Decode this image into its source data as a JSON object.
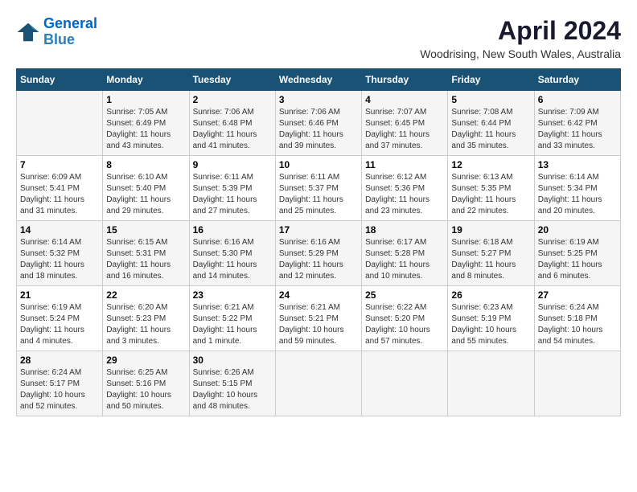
{
  "logo": {
    "name": "General",
    "name2": "Blue"
  },
  "title": "April 2024",
  "location": "Woodrising, New South Wales, Australia",
  "header_days": [
    "Sunday",
    "Monday",
    "Tuesday",
    "Wednesday",
    "Thursday",
    "Friday",
    "Saturday"
  ],
  "weeks": [
    [
      {
        "day": "",
        "info": ""
      },
      {
        "day": "1",
        "info": "Sunrise: 7:05 AM\nSunset: 6:49 PM\nDaylight: 11 hours\nand 43 minutes."
      },
      {
        "day": "2",
        "info": "Sunrise: 7:06 AM\nSunset: 6:48 PM\nDaylight: 11 hours\nand 41 minutes."
      },
      {
        "day": "3",
        "info": "Sunrise: 7:06 AM\nSunset: 6:46 PM\nDaylight: 11 hours\nand 39 minutes."
      },
      {
        "day": "4",
        "info": "Sunrise: 7:07 AM\nSunset: 6:45 PM\nDaylight: 11 hours\nand 37 minutes."
      },
      {
        "day": "5",
        "info": "Sunrise: 7:08 AM\nSunset: 6:44 PM\nDaylight: 11 hours\nand 35 minutes."
      },
      {
        "day": "6",
        "info": "Sunrise: 7:09 AM\nSunset: 6:42 PM\nDaylight: 11 hours\nand 33 minutes."
      }
    ],
    [
      {
        "day": "7",
        "info": "Sunrise: 6:09 AM\nSunset: 5:41 PM\nDaylight: 11 hours\nand 31 minutes."
      },
      {
        "day": "8",
        "info": "Sunrise: 6:10 AM\nSunset: 5:40 PM\nDaylight: 11 hours\nand 29 minutes."
      },
      {
        "day": "9",
        "info": "Sunrise: 6:11 AM\nSunset: 5:39 PM\nDaylight: 11 hours\nand 27 minutes."
      },
      {
        "day": "10",
        "info": "Sunrise: 6:11 AM\nSunset: 5:37 PM\nDaylight: 11 hours\nand 25 minutes."
      },
      {
        "day": "11",
        "info": "Sunrise: 6:12 AM\nSunset: 5:36 PM\nDaylight: 11 hours\nand 23 minutes."
      },
      {
        "day": "12",
        "info": "Sunrise: 6:13 AM\nSunset: 5:35 PM\nDaylight: 11 hours\nand 22 minutes."
      },
      {
        "day": "13",
        "info": "Sunrise: 6:14 AM\nSunset: 5:34 PM\nDaylight: 11 hours\nand 20 minutes."
      }
    ],
    [
      {
        "day": "14",
        "info": "Sunrise: 6:14 AM\nSunset: 5:32 PM\nDaylight: 11 hours\nand 18 minutes."
      },
      {
        "day": "15",
        "info": "Sunrise: 6:15 AM\nSunset: 5:31 PM\nDaylight: 11 hours\nand 16 minutes."
      },
      {
        "day": "16",
        "info": "Sunrise: 6:16 AM\nSunset: 5:30 PM\nDaylight: 11 hours\nand 14 minutes."
      },
      {
        "day": "17",
        "info": "Sunrise: 6:16 AM\nSunset: 5:29 PM\nDaylight: 11 hours\nand 12 minutes."
      },
      {
        "day": "18",
        "info": "Sunrise: 6:17 AM\nSunset: 5:28 PM\nDaylight: 11 hours\nand 10 minutes."
      },
      {
        "day": "19",
        "info": "Sunrise: 6:18 AM\nSunset: 5:27 PM\nDaylight: 11 hours\nand 8 minutes."
      },
      {
        "day": "20",
        "info": "Sunrise: 6:19 AM\nSunset: 5:25 PM\nDaylight: 11 hours\nand 6 minutes."
      }
    ],
    [
      {
        "day": "21",
        "info": "Sunrise: 6:19 AM\nSunset: 5:24 PM\nDaylight: 11 hours\nand 4 minutes."
      },
      {
        "day": "22",
        "info": "Sunrise: 6:20 AM\nSunset: 5:23 PM\nDaylight: 11 hours\nand 3 minutes."
      },
      {
        "day": "23",
        "info": "Sunrise: 6:21 AM\nSunset: 5:22 PM\nDaylight: 11 hours\nand 1 minute."
      },
      {
        "day": "24",
        "info": "Sunrise: 6:21 AM\nSunset: 5:21 PM\nDaylight: 10 hours\nand 59 minutes."
      },
      {
        "day": "25",
        "info": "Sunrise: 6:22 AM\nSunset: 5:20 PM\nDaylight: 10 hours\nand 57 minutes."
      },
      {
        "day": "26",
        "info": "Sunrise: 6:23 AM\nSunset: 5:19 PM\nDaylight: 10 hours\nand 55 minutes."
      },
      {
        "day": "27",
        "info": "Sunrise: 6:24 AM\nSunset: 5:18 PM\nDaylight: 10 hours\nand 54 minutes."
      }
    ],
    [
      {
        "day": "28",
        "info": "Sunrise: 6:24 AM\nSunset: 5:17 PM\nDaylight: 10 hours\nand 52 minutes."
      },
      {
        "day": "29",
        "info": "Sunrise: 6:25 AM\nSunset: 5:16 PM\nDaylight: 10 hours\nand 50 minutes."
      },
      {
        "day": "30",
        "info": "Sunrise: 6:26 AM\nSunset: 5:15 PM\nDaylight: 10 hours\nand 48 minutes."
      },
      {
        "day": "",
        "info": ""
      },
      {
        "day": "",
        "info": ""
      },
      {
        "day": "",
        "info": ""
      },
      {
        "day": "",
        "info": ""
      }
    ]
  ]
}
